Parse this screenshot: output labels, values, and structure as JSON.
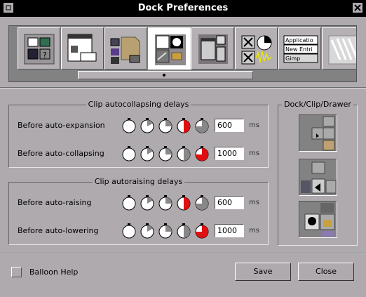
{
  "window": {
    "title": "Dock Preferences"
  },
  "icons": {
    "minimize": "minimize-icon",
    "close": "close-icon",
    "tiles": [
      "windows-icon",
      "files-icon",
      "filemanager-icon",
      "dock-icon",
      "icons-icon",
      "x-icon",
      "menu-icon",
      "texture-icon"
    ]
  },
  "tile_texts": {
    "menu_items": [
      "Applicatio",
      "New Entri",
      "Gimp"
    ]
  },
  "collapse": {
    "legend": "Clip autocollapsing delays",
    "rows": [
      {
        "label": "Before auto-expansion",
        "value": "600",
        "unit": "ms",
        "selected_clock": 3
      },
      {
        "label": "Before auto-collapsing",
        "value": "1000",
        "unit": "ms",
        "selected_clock": 4
      }
    ]
  },
  "raise": {
    "legend": "Clip autoraising delays",
    "rows": [
      {
        "label": "Before auto-raising",
        "value": "600",
        "unit": "ms",
        "selected_clock": 3
      },
      {
        "label": "Before auto-lowering",
        "value": "1000",
        "unit": "ms",
        "selected_clock": 4
      }
    ]
  },
  "dock_group": {
    "legend": "Dock/Clip/Drawer"
  },
  "footer": {
    "balloon_label": "Balloon Help",
    "balloon_checked": false,
    "save_label": "Save",
    "close_label": "Close"
  },
  "colors": {
    "accent": "#e01010",
    "background": "#aeaaae",
    "titlebar": "#000000"
  }
}
